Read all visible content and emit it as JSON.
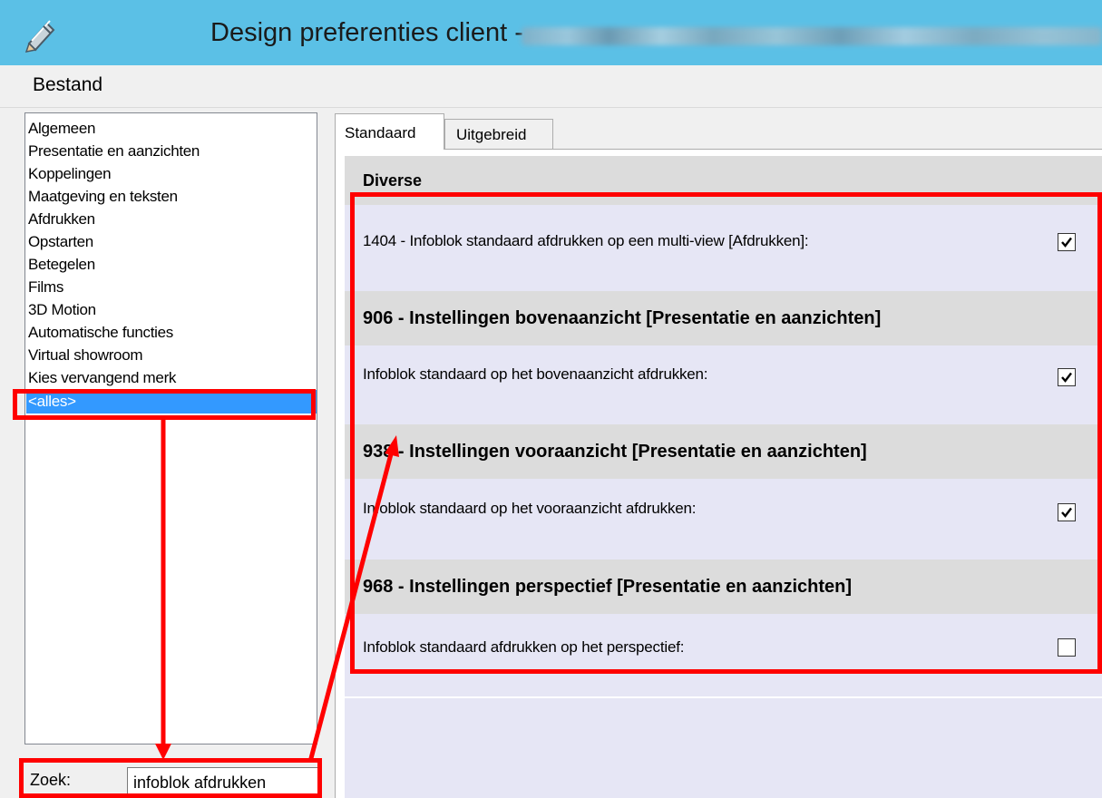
{
  "window": {
    "title": "Design preferenties client - "
  },
  "menu": {
    "items": [
      "Bestand"
    ]
  },
  "sidebar": {
    "items": [
      {
        "label": "Algemeen"
      },
      {
        "label": "Presentatie en aanzichten"
      },
      {
        "label": "Koppelingen"
      },
      {
        "label": "Maatgeving en teksten"
      },
      {
        "label": "Afdrukken"
      },
      {
        "label": "Opstarten"
      },
      {
        "label": "Betegelen"
      },
      {
        "label": "Films"
      },
      {
        "label": "3D Motion"
      },
      {
        "label": "Automatische functies"
      },
      {
        "label": "Virtual showroom"
      },
      {
        "label": "Kies vervangend merk"
      },
      {
        "label": "<alles>",
        "selected": true
      }
    ]
  },
  "search": {
    "label": "Zoek:",
    "value": "infoblok afdrukken"
  },
  "tabs": [
    {
      "label": "Standaard",
      "active": true
    },
    {
      "label": "Uitgebreid",
      "active": false
    }
  ],
  "sections": [
    {
      "header": "Diverse",
      "settings": [
        {
          "label": "1404 - Infoblok standaard afdrukken op een multi-view [Afdrukken]:",
          "checked": true
        }
      ]
    },
    {
      "header": "906 - Instellingen bovenaanzicht [Presentatie en aanzichten]",
      "settings": [
        {
          "label": "Infoblok standaard op het bovenaanzicht afdrukken:",
          "checked": true
        }
      ]
    },
    {
      "header": "938 - Instellingen vooraanzicht [Presentatie en aanzichten]",
      "settings": [
        {
          "label": "Infoblok standaard op het vooraanzicht afdrukken:",
          "checked": true
        }
      ]
    },
    {
      "header": "968 - Instellingen perspectief [Presentatie en aanzichten]",
      "settings": [
        {
          "label": "Infoblok standaard afdrukken op het perspectief:",
          "checked": false
        }
      ]
    }
  ],
  "colors": {
    "titlebar": "#5bc0e6",
    "selection": "#3399ff",
    "annotation": "#ff0000",
    "settings_background": "#e6e6f5",
    "section_header": "#dcdcdc"
  }
}
